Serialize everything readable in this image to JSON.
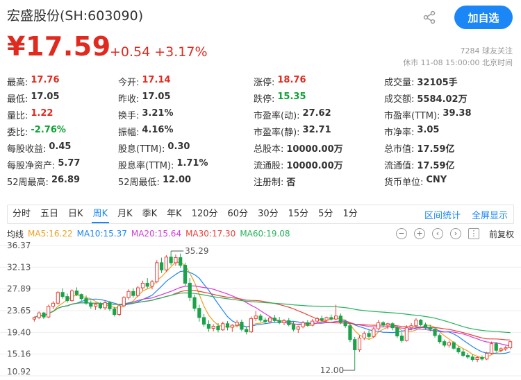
{
  "header": {
    "stock_name": "宏盛股份(SH:603090)",
    "add_button": "加自选",
    "price": "¥17.59",
    "change": "+0.54 +3.17%",
    "followers": "7284 球友关注",
    "market_status": "休市 11-08 15:00:00 北京时间"
  },
  "stats": [
    [
      {
        "k": "最高:",
        "v": "17.76",
        "c": "red"
      },
      {
        "k": "今开:",
        "v": "17.14",
        "c": "red"
      },
      {
        "k": "涨停:",
        "v": "18.76",
        "c": "red"
      },
      {
        "k": "成交量:",
        "v": "32105手",
        "c": ""
      }
    ],
    [
      {
        "k": "最低:",
        "v": "17.05",
        "c": ""
      },
      {
        "k": "昨收:",
        "v": "17.05",
        "c": ""
      },
      {
        "k": "跌停:",
        "v": "15.35",
        "c": "green"
      },
      {
        "k": "成交额:",
        "v": "5584.02万",
        "c": ""
      }
    ],
    [
      {
        "k": "量比:",
        "v": "1.22",
        "c": "red"
      },
      {
        "k": "换手:",
        "v": "3.21%",
        "c": ""
      },
      {
        "k": "市盈率(动):",
        "v": "27.62",
        "c": ""
      },
      {
        "k": "市盈率(TTM):",
        "v": "39.38",
        "c": ""
      }
    ],
    [
      {
        "k": "委比:",
        "v": "-2.76%",
        "c": "green"
      },
      {
        "k": "振幅:",
        "v": "4.16%",
        "c": ""
      },
      {
        "k": "市盈率(静):",
        "v": "32.71",
        "c": ""
      },
      {
        "k": "市净率:",
        "v": "3.05",
        "c": ""
      }
    ],
    [
      {
        "k": "每股收益:",
        "v": "0.45",
        "c": ""
      },
      {
        "k": "股息(TTM):",
        "v": "0.30",
        "c": ""
      },
      {
        "k": "总股本:",
        "v": "10000.00万",
        "c": ""
      },
      {
        "k": "总市值:",
        "v": "17.59亿",
        "c": ""
      }
    ],
    [
      {
        "k": "每股净资产:",
        "v": "5.77",
        "c": ""
      },
      {
        "k": "股息率(TTM):",
        "v": "1.71%",
        "c": ""
      },
      {
        "k": "流通股:",
        "v": "10000.00万",
        "c": ""
      },
      {
        "k": "流通值:",
        "v": "17.59亿",
        "c": ""
      }
    ],
    [
      {
        "k": "52周最高:",
        "v": "26.89",
        "c": ""
      },
      {
        "k": "52周最低:",
        "v": "12.00",
        "c": ""
      },
      {
        "k": "注册制:",
        "v": "否",
        "c": ""
      },
      {
        "k": "货币单位:",
        "v": "CNY",
        "c": ""
      }
    ]
  ],
  "tabs": [
    {
      "label": "分时",
      "active": false
    },
    {
      "label": "五日",
      "active": false
    },
    {
      "label": "日K",
      "active": false
    },
    {
      "label": "周K",
      "active": true
    },
    {
      "label": "月K",
      "active": false
    },
    {
      "label": "季K",
      "active": false
    },
    {
      "label": "年K",
      "active": false
    },
    {
      "label": "120分",
      "active": false
    },
    {
      "label": "60分",
      "active": false
    },
    {
      "label": "30分",
      "active": false
    },
    {
      "label": "15分",
      "active": false
    },
    {
      "label": "5分",
      "active": false
    },
    {
      "label": "1分",
      "active": false
    }
  ],
  "tab_links": {
    "interval": "区间统计",
    "fullscreen": "全屏显示"
  },
  "ma": {
    "label": "均线",
    "items": [
      {
        "text": "MA5:16.22",
        "color": "#f0a020"
      },
      {
        "text": "MA10:15.37",
        "color": "#1b86f5"
      },
      {
        "text": "MA20:15.64",
        "color": "#d63ad6"
      },
      {
        "text": "MA30:17.30",
        "color": "#e8423a"
      },
      {
        "text": "MA60:19.08",
        "color": "#25b35a"
      }
    ],
    "adjust": "前复权"
  },
  "chart_data": {
    "type": "candlestick",
    "y_ticks": [
      "36.37",
      "32.13",
      "27.89",
      "23.65",
      "19.40",
      "15.16",
      "10.92"
    ],
    "ylim": [
      10.92,
      36.37
    ],
    "annotations": [
      {
        "text": "35.29"
      },
      {
        "text": "12.00"
      }
    ],
    "candles": [
      [
        22.0,
        22.5,
        21.5,
        22.3
      ],
      [
        22.3,
        23.5,
        22.0,
        23.2
      ],
      [
        23.2,
        23.4,
        22.0,
        22.4
      ],
      [
        22.4,
        24.8,
        22.2,
        24.5
      ],
      [
        24.5,
        25.5,
        24.0,
        25.1
      ],
      [
        25.1,
        27.5,
        24.8,
        27.2
      ],
      [
        27.2,
        28.0,
        26.0,
        26.4
      ],
      [
        26.4,
        27.0,
        25.2,
        25.6
      ],
      [
        25.6,
        27.8,
        25.4,
        27.5
      ],
      [
        27.5,
        28.2,
        26.5,
        26.8
      ],
      [
        26.8,
        27.0,
        25.6,
        26.0
      ],
      [
        26.0,
        26.6,
        24.8,
        25.1
      ],
      [
        25.1,
        25.6,
        24.0,
        24.5
      ],
      [
        24.5,
        25.2,
        23.8,
        24.9
      ],
      [
        24.9,
        25.3,
        23.9,
        24.2
      ],
      [
        24.2,
        25.6,
        23.8,
        25.2
      ],
      [
        25.2,
        25.5,
        23.6,
        24.0
      ],
      [
        24.0,
        24.4,
        22.5,
        22.9
      ],
      [
        22.9,
        24.8,
        22.6,
        24.6
      ],
      [
        24.6,
        26.5,
        24.3,
        26.2
      ],
      [
        26.2,
        27.8,
        25.8,
        27.4
      ],
      [
        27.4,
        28.0,
        26.2,
        26.6
      ],
      [
        26.6,
        28.5,
        26.3,
        28.1
      ],
      [
        28.1,
        29.5,
        27.5,
        29.0
      ],
      [
        29.0,
        30.0,
        28.0,
        28.4
      ],
      [
        28.4,
        29.6,
        27.8,
        29.3
      ],
      [
        29.3,
        33.5,
        29.0,
        33.0
      ],
      [
        33.0,
        34.0,
        31.0,
        31.6
      ],
      [
        31.6,
        34.5,
        31.2,
        34.1
      ],
      [
        34.1,
        35.29,
        32.5,
        33.0
      ],
      [
        33.0,
        34.6,
        32.4,
        34.0
      ],
      [
        34.0,
        34.8,
        32.0,
        32.5
      ],
      [
        32.5,
        33.0,
        28.5,
        29.0
      ],
      [
        29.0,
        30.0,
        25.5,
        26.2
      ],
      [
        26.2,
        26.8,
        23.5,
        24.1
      ],
      [
        24.1,
        24.8,
        21.5,
        22.3
      ],
      [
        22.3,
        23.0,
        20.5,
        21.0
      ],
      [
        21.0,
        21.8,
        19.5,
        20.2
      ],
      [
        20.2,
        21.0,
        19.6,
        20.6
      ],
      [
        20.6,
        21.2,
        19.4,
        19.9
      ],
      [
        19.9,
        21.5,
        19.7,
        21.1
      ],
      [
        21.1,
        21.6,
        19.8,
        20.4
      ],
      [
        20.4,
        21.0,
        19.5,
        20.8
      ],
      [
        20.8,
        21.8,
        20.4,
        21.4
      ],
      [
        21.4,
        21.9,
        19.6,
        20.0
      ],
      [
        20.0,
        20.6,
        19.0,
        19.5
      ],
      [
        19.5,
        22.5,
        19.3,
        22.1
      ],
      [
        22.1,
        23.6,
        21.6,
        22.6
      ],
      [
        22.6,
        23.0,
        21.4,
        21.8
      ],
      [
        21.8,
        22.3,
        21.0,
        21.5
      ],
      [
        21.5,
        22.6,
        21.2,
        22.2
      ],
      [
        22.2,
        22.8,
        21.4,
        21.7
      ],
      [
        21.7,
        22.4,
        21.0,
        21.3
      ],
      [
        21.3,
        22.0,
        20.8,
        21.7
      ],
      [
        21.7,
        22.2,
        20.6,
        20.9
      ],
      [
        20.9,
        21.5,
        19.6,
        20.0
      ],
      [
        20.0,
        20.7,
        19.3,
        20.5
      ],
      [
        20.5,
        21.6,
        20.2,
        21.3
      ],
      [
        21.3,
        21.8,
        20.5,
        20.8
      ],
      [
        20.8,
        22.0,
        20.6,
        21.6
      ],
      [
        21.6,
        22.4,
        21.2,
        22.1
      ],
      [
        22.1,
        22.7,
        21.5,
        21.8
      ],
      [
        21.8,
        22.5,
        21.3,
        22.3
      ],
      [
        22.3,
        22.9,
        21.7,
        22.0
      ],
      [
        22.0,
        24.8,
        21.8,
        22.6
      ],
      [
        22.6,
        23.1,
        21.0,
        21.4
      ],
      [
        21.4,
        21.9,
        20.3,
        20.7
      ],
      [
        20.7,
        21.3,
        17.5,
        18.0
      ],
      [
        18.0,
        18.5,
        12.0,
        16.0
      ],
      [
        16.0,
        18.8,
        15.6,
        18.3
      ],
      [
        18.3,
        19.6,
        17.9,
        19.2
      ],
      [
        19.2,
        19.8,
        18.2,
        18.6
      ],
      [
        18.6,
        20.4,
        18.3,
        20.1
      ],
      [
        20.1,
        21.8,
        19.8,
        21.3
      ],
      [
        21.3,
        21.6,
        20.4,
        20.8
      ],
      [
        20.8,
        21.3,
        20.0,
        21.1
      ],
      [
        21.1,
        21.4,
        19.8,
        20.3
      ],
      [
        20.3,
        20.7,
        18.3,
        18.7
      ],
      [
        18.7,
        19.4,
        17.4,
        17.8
      ],
      [
        17.8,
        20.8,
        17.6,
        20.3
      ],
      [
        20.3,
        21.2,
        19.8,
        20.7
      ],
      [
        20.7,
        22.2,
        20.4,
        21.8
      ],
      [
        21.8,
        22.0,
        20.6,
        20.9
      ],
      [
        20.9,
        21.3,
        20.0,
        20.4
      ],
      [
        20.4,
        20.9,
        19.6,
        20.0
      ],
      [
        20.0,
        20.4,
        18.4,
        18.8
      ],
      [
        18.8,
        19.2,
        17.2,
        17.6
      ],
      [
        17.6,
        18.0,
        16.5,
        16.9
      ],
      [
        16.9,
        17.8,
        16.4,
        17.4
      ],
      [
        17.4,
        17.7,
        16.0,
        16.3
      ],
      [
        16.3,
        16.7,
        15.2,
        15.6
      ],
      [
        15.6,
        16.2,
        14.6,
        14.9
      ],
      [
        14.9,
        15.4,
        14.2,
        14.6
      ],
      [
        14.6,
        15.1,
        13.7,
        14.1
      ],
      [
        14.1,
        14.8,
        13.6,
        14.5
      ],
      [
        14.5,
        14.9,
        13.9,
        14.2
      ],
      [
        14.2,
        15.6,
        14.0,
        15.3
      ],
      [
        15.3,
        17.6,
        15.1,
        17.2
      ],
      [
        17.2,
        17.5,
        15.6,
        15.9
      ],
      [
        15.9,
        16.5,
        15.5,
        16.2
      ],
      [
        16.2,
        16.8,
        15.8,
        16.4
      ],
      [
        16.4,
        17.76,
        16.1,
        17.59
      ]
    ],
    "ma_periods": [
      5,
      10,
      20,
      30,
      60
    ],
    "ma_colors": [
      "#f0a020",
      "#1b86f5",
      "#d63ad6",
      "#e8423a",
      "#25b35a"
    ]
  }
}
